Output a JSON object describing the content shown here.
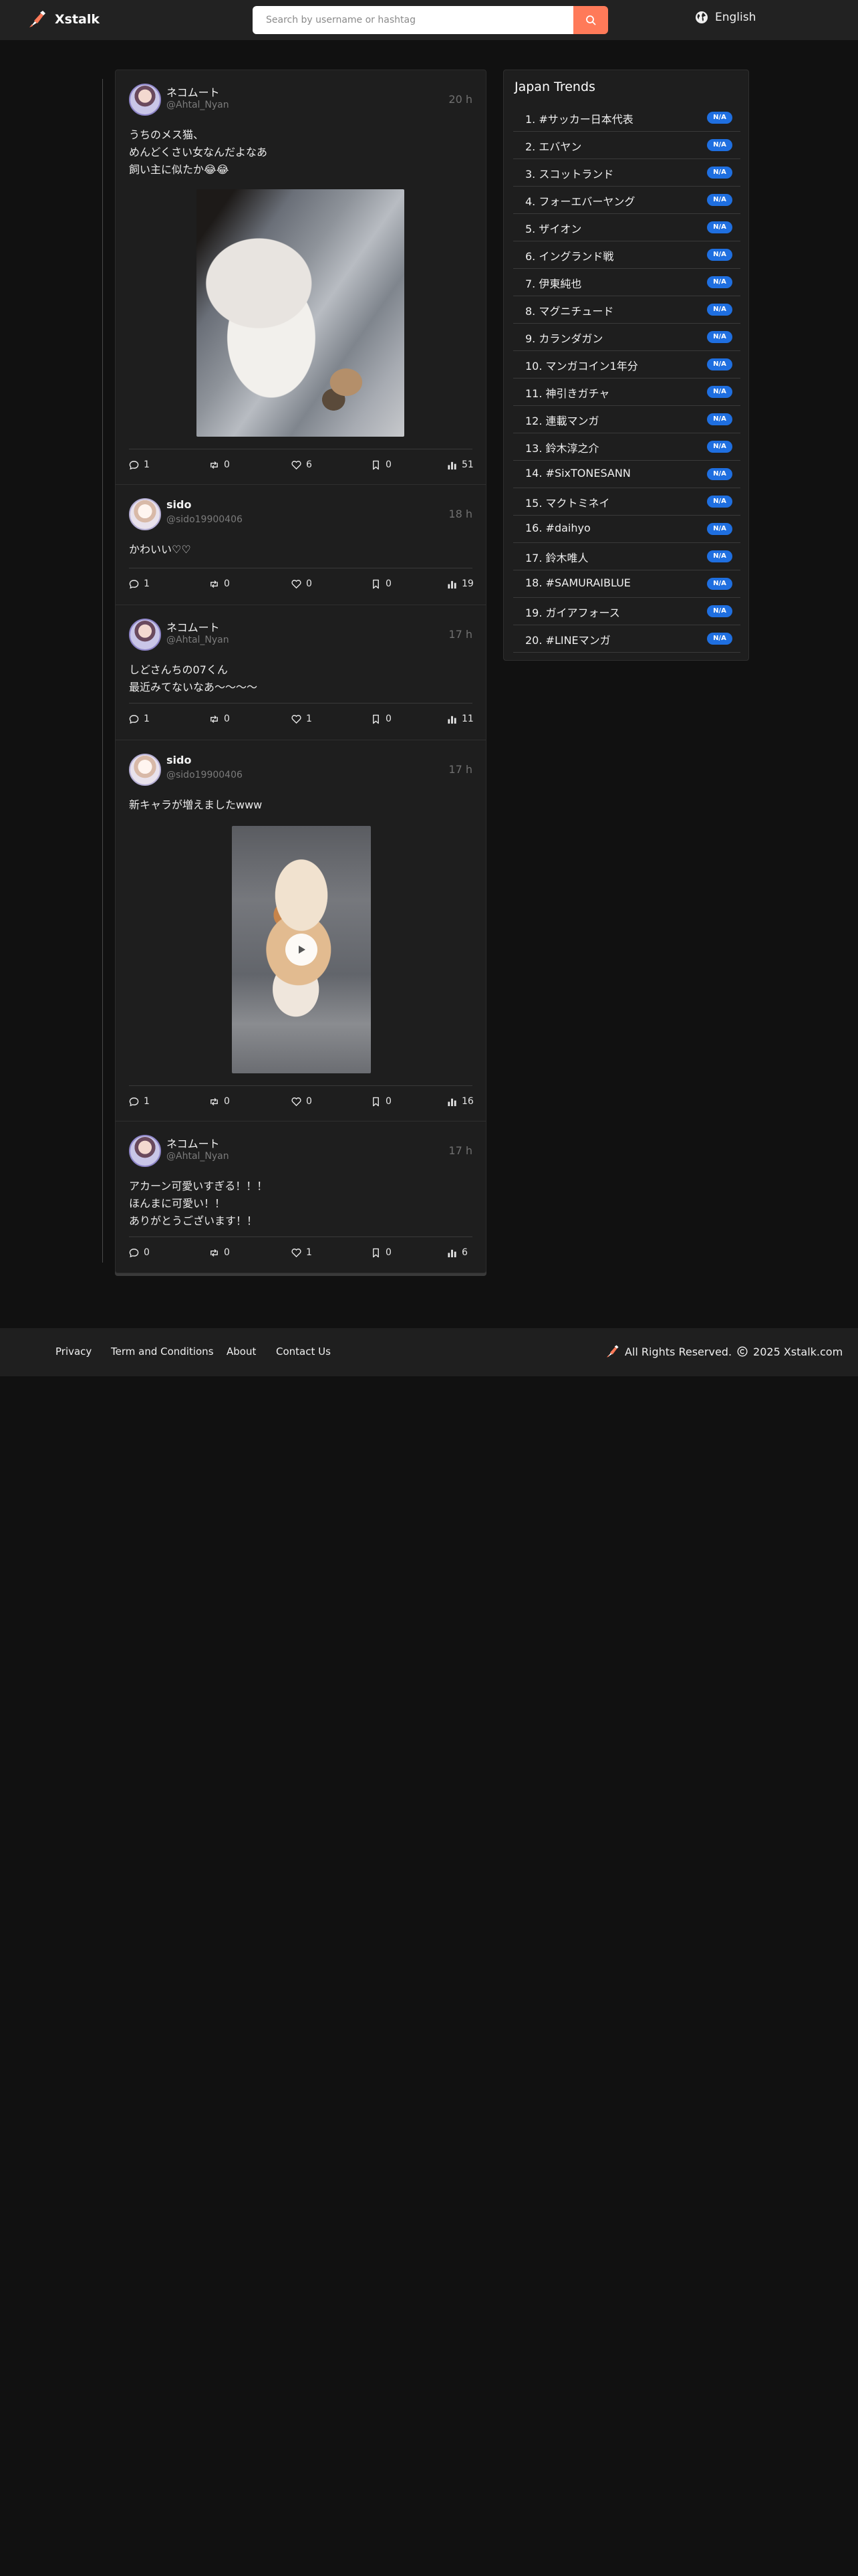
{
  "header": {
    "brand": "Xstalk",
    "search_placeholder": "Search by username or hashtag",
    "language": "English",
    "accent": "#ff7a59"
  },
  "posts": [
    {
      "name": "ネコムート",
      "handle": "@Ahtal_Nyan",
      "time": "20 h",
      "text": "うちのメス猫、\nめんどくさい女なんだよなあ\n飼い主に似たか😂😂",
      "media": "photo-white-cat",
      "stats": {
        "replies": "1",
        "reposts": "0",
        "likes": "6",
        "bookmarks": "0",
        "views": "51"
      }
    },
    {
      "name": "sido",
      "handle": "@sido19900406",
      "time": "18 h",
      "text": "かわいい♡♡",
      "stats": {
        "replies": "1",
        "reposts": "0",
        "likes": "0",
        "bookmarks": "0",
        "views": "19"
      }
    },
    {
      "name": "ネコムート",
      "handle": "@Ahtal_Nyan",
      "time": "17 h",
      "text": "しどさんちの07くん\n最近みてないなあ〜〜〜〜",
      "stats": {
        "replies": "1",
        "reposts": "0",
        "likes": "1",
        "bookmarks": "0",
        "views": "11"
      }
    },
    {
      "name": "sido",
      "handle": "@sido19900406",
      "time": "17 h",
      "text": "新キャラが増えましたwww",
      "media": "video-calico-cat",
      "stats": {
        "replies": "1",
        "reposts": "0",
        "likes": "0",
        "bookmarks": "0",
        "views": "16"
      }
    },
    {
      "name": "ネコムート",
      "handle": "@Ahtal_Nyan",
      "time": "17 h",
      "text": "アカーン可愛いすぎる！！！\nほんまに可愛い！！\nありがとうございます！！",
      "stats": {
        "replies": "0",
        "reposts": "0",
        "likes": "1",
        "bookmarks": "0",
        "views": "6"
      }
    }
  ],
  "trends": {
    "title": "Japan Trends",
    "badge_color": "#1f6fe0",
    "items": [
      {
        "label": "1. #サッカー日本代表",
        "badge": "N/A"
      },
      {
        "label": "2. エバヤン",
        "badge": "N/A"
      },
      {
        "label": "3. スコットランド",
        "badge": "N/A"
      },
      {
        "label": "4. フォーエバーヤング",
        "badge": "N/A"
      },
      {
        "label": "5. ザイオン",
        "badge": "N/A"
      },
      {
        "label": "6. イングランド戦",
        "badge": "N/A"
      },
      {
        "label": "7. 伊東純也",
        "badge": "N/A"
      },
      {
        "label": "8. マグニチュード",
        "badge": "N/A"
      },
      {
        "label": "9. カランダガン",
        "badge": "N/A"
      },
      {
        "label": "10. マンガコイン1年分",
        "badge": "N/A"
      },
      {
        "label": "11. 神引きガチャ",
        "badge": "N/A"
      },
      {
        "label": "12. 連載マンガ",
        "badge": "N/A"
      },
      {
        "label": "13. 鈴木淳之介",
        "badge": "N/A"
      },
      {
        "label": "14. #SixTONESANN",
        "badge": "N/A"
      },
      {
        "label": "15. マクトミネイ",
        "badge": "N/A"
      },
      {
        "label": "16. #daihyo",
        "badge": "N/A"
      },
      {
        "label": "17. 鈴木唯人",
        "badge": "N/A"
      },
      {
        "label": "18. #SAMURAIBLUE",
        "badge": "N/A"
      },
      {
        "label": "19. ガイアフォース",
        "badge": "N/A"
      },
      {
        "label": "20. #LINEマンガ",
        "badge": "N/A"
      }
    ]
  },
  "footer": {
    "links": [
      "Privacy",
      "Term and Conditions",
      "About",
      "Contact Us"
    ],
    "rights": "All Rights Reserved.",
    "copyright": "2025 Xstalk.com"
  }
}
